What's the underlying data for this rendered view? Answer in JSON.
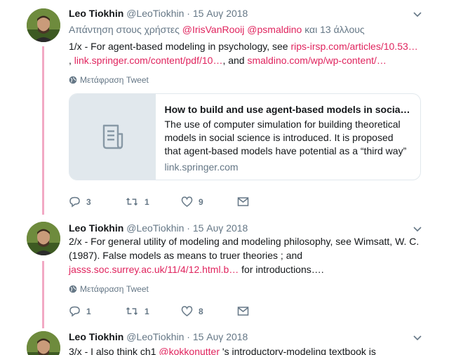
{
  "tweets": [
    {
      "name": "Leo Tiokhin",
      "handle": "@LeoTiokhin",
      "dot": "·",
      "date": "15 Αυγ 2018",
      "reply_prefix": "Απάντηση στους χρήστες",
      "reply_mention1": "@IrisVanRooij",
      "reply_mention2": "@psmaldino",
      "reply_suffix": "και 13 άλλους",
      "text_a": "1/x - For agent-based modeling in psychology, see",
      "link1": "rips-irsp.com/articles/10.53…",
      "text_b": ",",
      "link2": "link.springer.com/content/pdf/10…",
      "text_c": ", and",
      "link3": "smaldino.com/wp/wp-content/…",
      "translate": "Μετάφραση Tweet",
      "card": {
        "title": "How to build and use agent-based models in socia…",
        "description": "The use of computer simulation for building theoretical models in social science is introduced. It is proposed that agent-based models have potential as a “third way” of …",
        "domain": "link.springer.com",
        "icon": "document-icon"
      },
      "replies": "3",
      "retweets": "1",
      "likes": "9"
    },
    {
      "name": "Leo Tiokhin",
      "handle": "@LeoTiokhin",
      "dot": "·",
      "date": "15 Αυγ 2018",
      "text_a": "2/x - For general utility of modeling and modeling philosophy, see Wimsatt, W. C. (1987). False models as means to truer theories ; and",
      "link1": "jasss.soc.surrey.ac.uk/11/4/12.html.b…",
      "text_b": "for introductions….",
      "translate": "Μετάφραση Tweet",
      "replies": "1",
      "retweets": "1",
      "likes": "8"
    },
    {
      "name": "Leo Tiokhin",
      "handle": "@LeoTiokhin",
      "dot": "·",
      "date": "15 Αυγ 2018",
      "text_a": "3/x - I also think ch1",
      "mention": "@kokkonutter",
      "text_b": "'s introductory-modeling textbook is"
    }
  ],
  "colors": {
    "accent": "#e0245e",
    "thread_line": "#f2a9c4",
    "muted": "#657786"
  },
  "icons": [
    "chevron-down-icon",
    "globe-icon",
    "reply-icon",
    "retweet-icon",
    "like-icon",
    "dm-icon",
    "document-icon"
  ]
}
